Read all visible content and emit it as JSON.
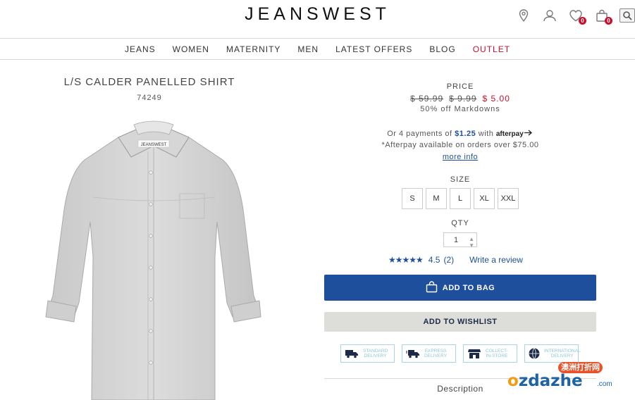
{
  "header": {
    "logo": "JEANSWEST",
    "wishlist_count": "0",
    "bag_count": "0"
  },
  "nav": {
    "items": [
      "JEANS",
      "WOMEN",
      "MATERNITY",
      "MEN",
      "LATEST OFFERS",
      "BLOG",
      "OUTLET"
    ]
  },
  "product": {
    "title": "L/S CALDER PANELLED SHIRT",
    "code": "74249",
    "image_brand_label": "JEANSWEST"
  },
  "price": {
    "label": "PRICE",
    "was1": "$ 59.99",
    "was2": "$ 9.99",
    "now": "$ 5.00",
    "markdown": "50% off Markdowns"
  },
  "afterpay": {
    "prefix": "Or 4 payments of",
    "amount": "$1.25",
    "with": "with",
    "logo": "afterpay",
    "note": "*Afterpay available on orders over $75.00",
    "more_info": "more info"
  },
  "size": {
    "label": "SIZE",
    "options": [
      "S",
      "M",
      "L",
      "XL",
      "XXL"
    ]
  },
  "qty": {
    "label": "QTY",
    "value": "1"
  },
  "rating": {
    "score": "4.5",
    "count": "(2)",
    "write_review": "Write a review"
  },
  "actions": {
    "add_to_bag": "ADD TO BAG",
    "add_to_wishlist": "ADD TO WISHLIST"
  },
  "delivery": [
    {
      "icon": "truck-icon",
      "line1": "STANDARD",
      "line2": "DELIVERY"
    },
    {
      "icon": "express-truck-icon",
      "line1": "EXPRESS",
      "line2": "DELIVERY"
    },
    {
      "icon": "store-icon",
      "line1": "COLLECT-",
      "line2": "IN-STORE"
    },
    {
      "icon": "globe-icon",
      "line1": "INTERNATIONAL",
      "line2": "DELIVERY"
    }
  ],
  "description": {
    "title": "Description"
  },
  "watermark": {
    "tag": "澳洲打折网",
    "main_o": "o",
    "main_rest": "zdazhe",
    "suffix": ".com"
  },
  "colors": {
    "brand_blue": "#1e4f9c",
    "sale_red": "#c8102e",
    "wishlist_bg": "#ddddd9"
  }
}
